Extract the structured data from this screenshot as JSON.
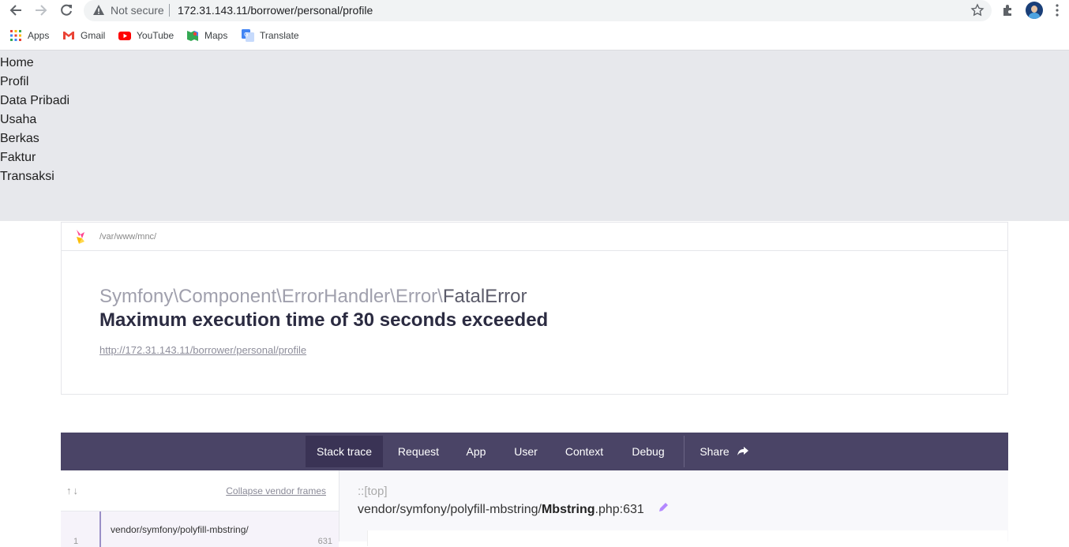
{
  "browser": {
    "security_label": "Not secure",
    "url": "172.31.143.11/borrower/personal/profile",
    "bookmarks": [
      {
        "label": "Apps",
        "icon": "apps-grid-icon"
      },
      {
        "label": "Gmail",
        "icon": "gmail-icon"
      },
      {
        "label": "YouTube",
        "icon": "youtube-icon"
      },
      {
        "label": "Maps",
        "icon": "maps-icon"
      },
      {
        "label": "Translate",
        "icon": "translate-icon"
      }
    ]
  },
  "app_nav": {
    "items": [
      "Home",
      "Profil",
      "Data Pribadi",
      "Usaha",
      "Berkas",
      "Faktur",
      "Transaksi"
    ]
  },
  "error": {
    "project_path": "/var/www/mnc/",
    "exception_namespace": "Symfony\\Component\\ErrorHandler\\Error\\",
    "exception_class": "FatalError",
    "message": "Maximum execution time of 30 seconds exceeded",
    "url": "http://172.31.143.11/borrower/personal/profile"
  },
  "tabs": {
    "stack_trace": "Stack trace",
    "request": "Request",
    "app": "App",
    "user": "User",
    "context": "Context",
    "debug": "Debug",
    "share": "Share"
  },
  "stack": {
    "collapse_label": "Collapse vendor frames",
    "frame_file": "vendor/symfony/polyfill-mbstring/",
    "frame_number": "1",
    "frame_line": "631",
    "top_label": "::[top]",
    "file_dir": "vendor/symfony/polyfill-mbstring/",
    "file_name": "Mbstring",
    "file_ext_line": ".php:631"
  },
  "colors": {
    "tab_bar": "#4a4466",
    "tab_active": "#3a3355",
    "nav_bg": "#e7e8ec"
  }
}
